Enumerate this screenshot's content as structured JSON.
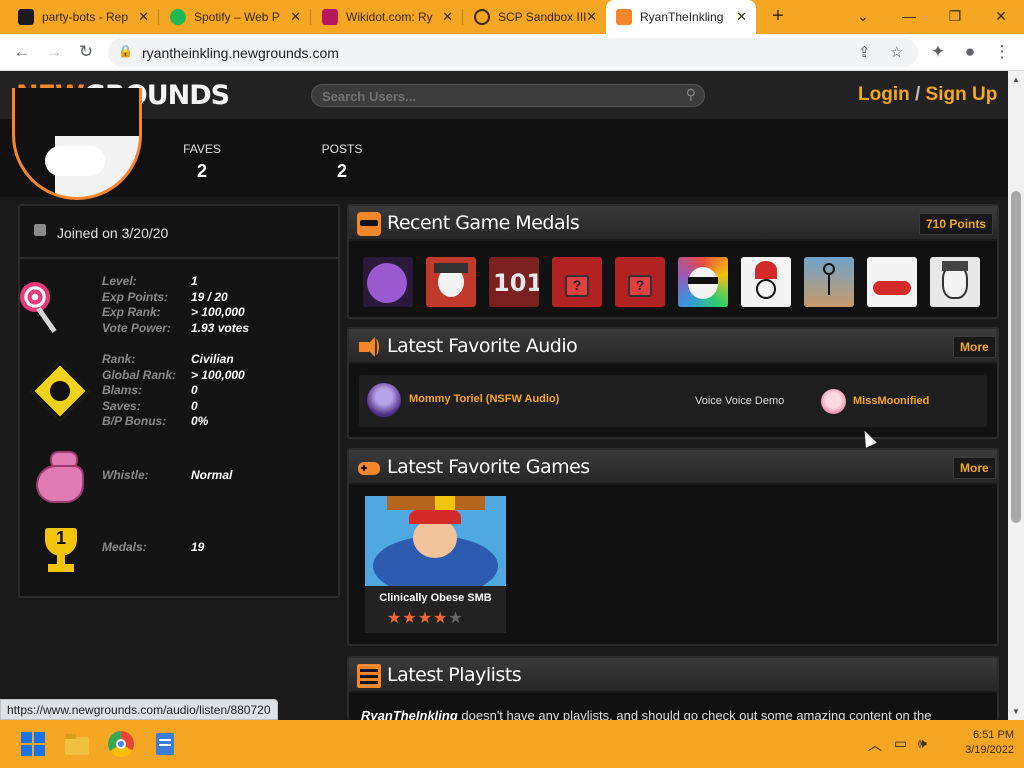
{
  "browser": {
    "tabs": [
      {
        "label": "party-bots - Rep",
        "color": "#1b1b1b"
      },
      {
        "label": "Spotify – Web P",
        "color": "#1db954"
      },
      {
        "label": "Wikidot.com: Ry",
        "color": "#b5195b"
      },
      {
        "label": "SCP Sandbox III",
        "color": "#f5a623"
      },
      {
        "label": "RyanTheInkling",
        "color": "#f5862a"
      }
    ],
    "new_tab": "+",
    "url": "ryantheinkling.newgrounds.com",
    "status_url": "https://www.newgrounds.com/audio/listen/880720"
  },
  "site": {
    "logo_new": "NEW",
    "logo_grounds": "GROUNDS",
    "search_placeholder": "Search Users...",
    "login": "Login",
    "slash": "/",
    "signup": "Sign Up",
    "brand_orange": "#f5862a",
    "accent": "#f5a623"
  },
  "profile": {
    "faves_label": "FAVES",
    "faves_value": "2",
    "posts_label": "POSTS",
    "posts_value": "2"
  },
  "sidebar": {
    "joined": "Joined on 3/20/20",
    "level_stats": [
      {
        "k": "Level:",
        "v": "1"
      },
      {
        "k": "Exp Points:",
        "v": "19 / 20"
      },
      {
        "k": "Exp Rank:",
        "v": "> 100,000"
      },
      {
        "k": "Vote Power:",
        "v": "1.93 votes"
      }
    ],
    "rank_stats": [
      {
        "k": "Rank:",
        "v": "Civilian"
      },
      {
        "k": "Global Rank:",
        "v": "> 100,000"
      },
      {
        "k": "Blams:",
        "v": "0"
      },
      {
        "k": "Saves:",
        "v": "0"
      },
      {
        "k": "B/P Bonus:",
        "v": "0%"
      }
    ],
    "whistle": {
      "k": "Whistle:",
      "v": "Normal"
    },
    "medals": {
      "k": "Medals:",
      "v": "19"
    },
    "trophy_number": "1"
  },
  "medals_panel": {
    "title": "Recent Game Medals",
    "points": "710 Points",
    "medal_icons": [
      "purple-dino-medal-icon",
      "hat-guy-medal-icon",
      "101-medal-icon",
      "locked-medal-icon",
      "locked-medal-icon",
      "sunglasses-face-medal-icon",
      "red-hat-stickman-medal-icon",
      "stickman-medal-icon",
      "red-lips-face-medal-icon",
      "angry-face-medal-icon"
    ]
  },
  "audio_panel": {
    "title": "Latest Favorite Audio",
    "more": "More",
    "track_title": "Mommy Toriel (NSFW Audio)",
    "track_genre": "Voice Voice Demo",
    "track_author": "MissMoonified"
  },
  "games_panel": {
    "title": "Latest Favorite Games",
    "more": "More",
    "game_title": "Clinically Obese SMB",
    "rating_stars": 4
  },
  "playlists_panel": {
    "title": "Latest Playlists",
    "text_user": "RyanTheInkling",
    "text_rest": " doesn't have any playlists, and should go check out some amazing content on the"
  },
  "taskbar": {
    "time": "6:51 PM",
    "date": "3/19/2022"
  }
}
